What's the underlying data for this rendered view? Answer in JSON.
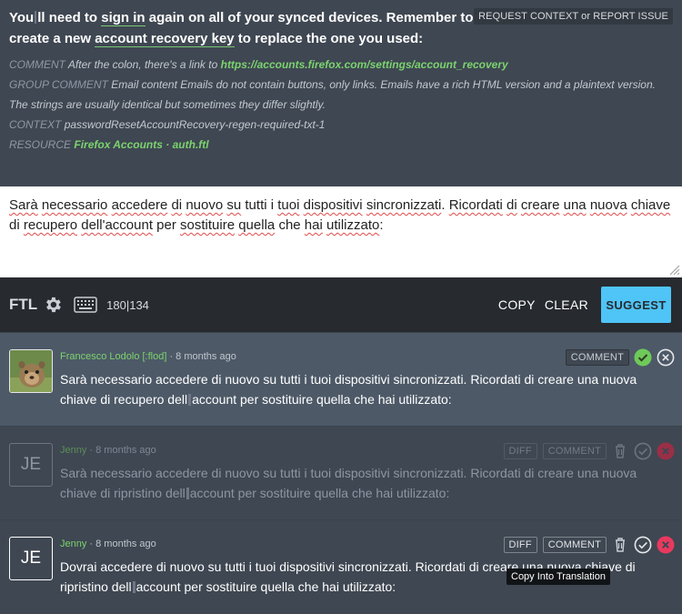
{
  "source": {
    "text_1": "You",
    "text_2": "ll need to ",
    "link_sign_in": "sign in",
    "text_3": " again on all of your synced devices. Remember to create a new ",
    "link_recovery": "account recovery key",
    "text_4": " to replace the one you used:",
    "request_button": "REQUEST CONTEXT or REPORT ISSUE",
    "comment_label": "COMMENT",
    "comment_text": "After the colon, there's a link to ",
    "comment_link": "https://accounts.firefox.com/settings/account_recovery",
    "group_label": "GROUP COMMENT",
    "group_text": "Email content Emails do not contain buttons, only links. Emails have a rich HTML version and a plaintext version. The strings are usually identical but sometimes they differ slightly.",
    "context_label": "CONTEXT",
    "context_text": "passwordResetAccountRecovery-regen-required-txt-1",
    "resource_label": "RESOURCE",
    "resource_project": "Firefox Accounts",
    "resource_sep": " · ",
    "resource_file": "auth.ftl"
  },
  "editor": {
    "w1": "Sarà",
    "w2": "necessario",
    "w3": "accedere",
    "w4": "di",
    "w5": "nuovo",
    "w6": "su",
    "w7": "tutti i",
    "w8": "tuoi",
    "w9": "dispositivi",
    "w10": "sincronizzati",
    "w11": ". ",
    "w12": "Ricordati",
    "w13": "di",
    "w14": "creare",
    "w15": "una",
    "w16": "nuova",
    "w17": "chiave",
    "w18": "di",
    "w19": "recupero",
    "w20": "dell'account",
    "w21": "per",
    "w22": "sostituire",
    "w23": "quella",
    "w24": "che",
    "w25": "hai",
    "w26": "utilizzato",
    "w27": ":"
  },
  "toolbar": {
    "ftl": "FTL",
    "counter": "180|134",
    "copy": "COPY",
    "clear": "CLEAR",
    "suggest": "SUGGEST"
  },
  "history": [
    {
      "user": "Francesco Lodolo [:flod]",
      "time": " · 8 months ago",
      "text_a": "Sarà necessario accedere di nuovo su tutti i tuoi dispositivi sincronizzati. Ricordati di creare una nuova chiave di recupero dell",
      "text_b": "account per sostituire quella che hai utilizzato:",
      "comment": "COMMENT"
    },
    {
      "initials": "JE",
      "user": "Jenny",
      "time": " · 8 months ago",
      "text_a": "Sarà necessario accedere di nuovo su tutti i tuoi dispositivi sincronizzati. Ricordati di creare una nuova chiave di ripristino dell",
      "text_b": "account per sostituire quella che hai utilizzato:",
      "diff": "DIFF",
      "comment": "COMMENT"
    },
    {
      "initials": "JE",
      "user": "Jenny",
      "time": " · 8 months ago",
      "text_a": "Dovrai accedere di nuovo su tutti i tuoi dispositivi sincronizzati. Ricordati di creare una nuova chiave di ripristino dell",
      "text_b": "account per sostituire quella che hai utilizzato:",
      "diff": "DIFF",
      "comment": "COMMENT"
    }
  ],
  "tooltip": "Copy Into Translation",
  "colors": {
    "accent": "#4fc4f6",
    "approved": "#6fc95a",
    "rejected": "#e8395f",
    "link_green": "#7bd36e"
  }
}
